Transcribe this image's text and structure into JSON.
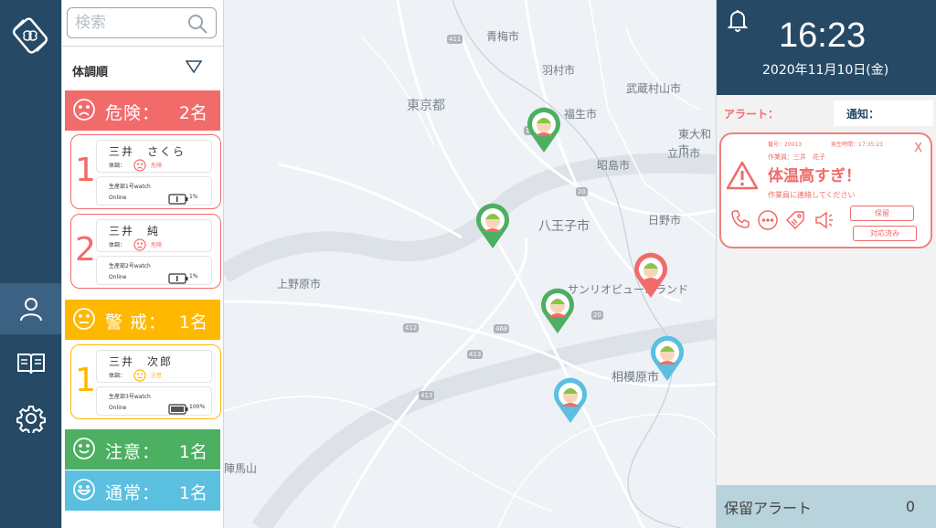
{
  "search": {
    "placeholder": "検索"
  },
  "sort": {
    "label": "体調順"
  },
  "categories": [
    {
      "name": "危険：",
      "count": "2名",
      "color": "#f26b6b"
    },
    {
      "name": "警 戒：",
      "count": "1名",
      "color": "#ffb800"
    },
    {
      "name": "注意：",
      "count": "1名",
      "color": "#4caf62"
    },
    {
      "name": "通常：",
      "count": "1名",
      "color": "#5bbfe0"
    }
  ],
  "workers": [
    {
      "rank": "1",
      "name": "三井　さくら",
      "condition_label": "体調：",
      "condition": "危険",
      "device": "生産部1号watch",
      "status": "Online",
      "battery": "1%",
      "battery_level": 0.01
    },
    {
      "rank": "2",
      "name": "三井　純",
      "condition_label": "体調：",
      "condition": "危険",
      "device": "生産部2号watch",
      "status": "Online",
      "battery": "1%",
      "battery_level": 0.01
    },
    {
      "rank": "1",
      "name": "三井　次郎",
      "condition_label": "体調：",
      "condition": "注意",
      "device": "生産部3号watch",
      "status": "Online",
      "battery": "100%",
      "battery_level": 1.0
    }
  ],
  "map": {
    "labels": [
      "青梅市",
      "羽村市",
      "東京都",
      "福生市",
      "昭島市",
      "武蔵村山市",
      "立川市",
      "東大和市",
      "八王子市",
      "日野市",
      "上野原市",
      "相模原市",
      "サンリオピューロランド",
      "陣馬山"
    ],
    "shields": [
      "411",
      "16",
      "20",
      "412",
      "413",
      "413",
      "468",
      "20"
    ]
  },
  "header": {
    "time": "16:23",
    "date": "2020年11月10日(金)"
  },
  "tabs": {
    "alert": "アラート：",
    "notice": "通知："
  },
  "alert": {
    "number": "番号：20013",
    "occurred": "発生時間：17:35:23",
    "worker": "作業員：三井　花子",
    "title": "体温高すぎ！",
    "message": "作業員に連絡してください",
    "close": "X",
    "hold_button": "保留",
    "done_button": "対応済み"
  },
  "footer": {
    "label": "保留アラート",
    "count": "0"
  },
  "colors": {
    "nav": "#264a66",
    "danger": "#f26b6b",
    "warning": "#ffb800",
    "caution": "#4caf62",
    "normal": "#5bbfe0"
  }
}
